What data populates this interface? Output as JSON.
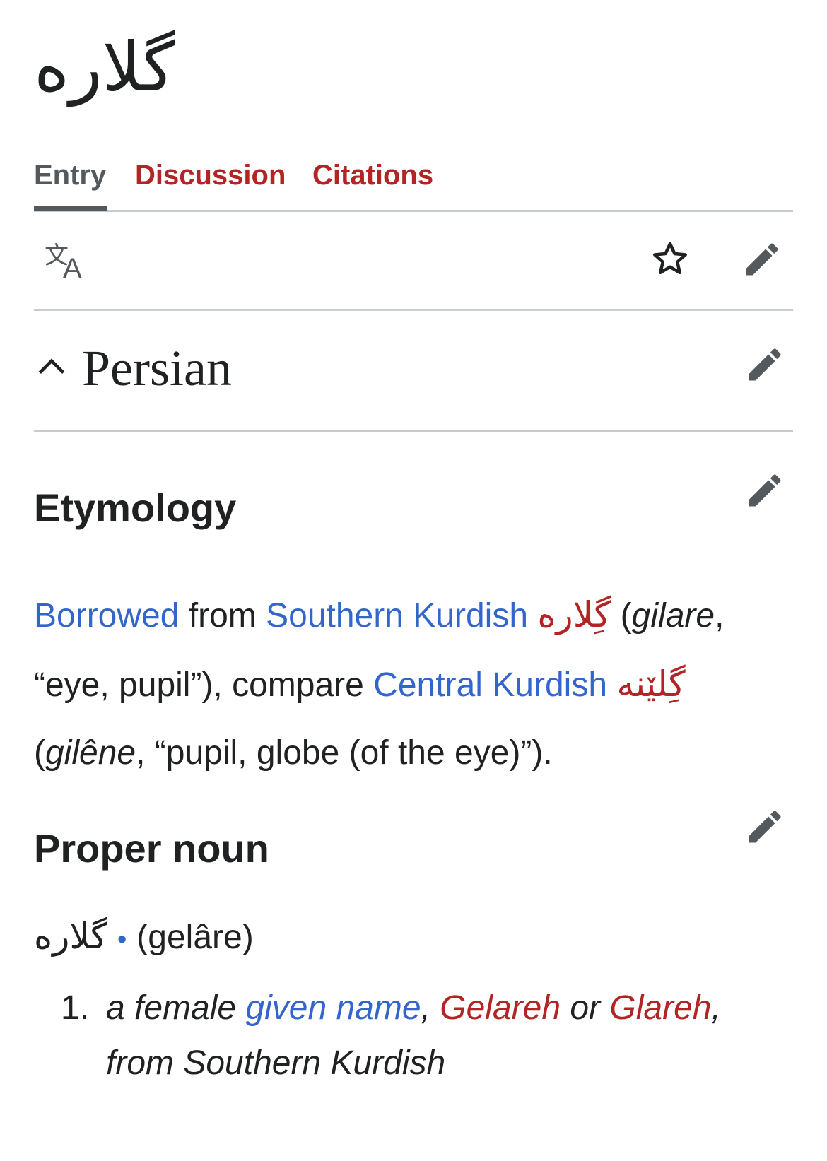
{
  "page": {
    "title": "گلاره"
  },
  "tabs": [
    {
      "label": "Entry"
    },
    {
      "label": "Discussion"
    },
    {
      "label": "Citations"
    }
  ],
  "toolbar": {
    "icons": [
      "language-icon",
      "star-icon",
      "edit-pencil-icon"
    ]
  },
  "section": {
    "language": "Persian"
  },
  "etymology": {
    "heading": "Etymology",
    "borrowed": "Borrowed",
    "from": " from ",
    "lang1": "Southern Kurdish",
    "word1": "گِلاره",
    "paren1_open": " (",
    "translit1": "gilare",
    "gloss1": ", “eye, pupil”), compare ",
    "lang2": "Central Kurdish",
    "word2": "گِلێنە",
    "paren2_open": " (",
    "translit2": "gilêne",
    "gloss2": ", “pupil, globe (of the eye)”)."
  },
  "proper_noun": {
    "heading": "Proper noun",
    "headword": "گلاره",
    "dot": "•",
    "translit": "(gelâre)"
  },
  "definition": {
    "number": "1.",
    "prefix": "a female ",
    "link_given_name": "given name",
    "comma1": ", ",
    "link_gelareh": "Gelareh",
    "or": " or ",
    "link_glareh": "Glareh",
    "suffix": ", from Southern Kurdish"
  }
}
